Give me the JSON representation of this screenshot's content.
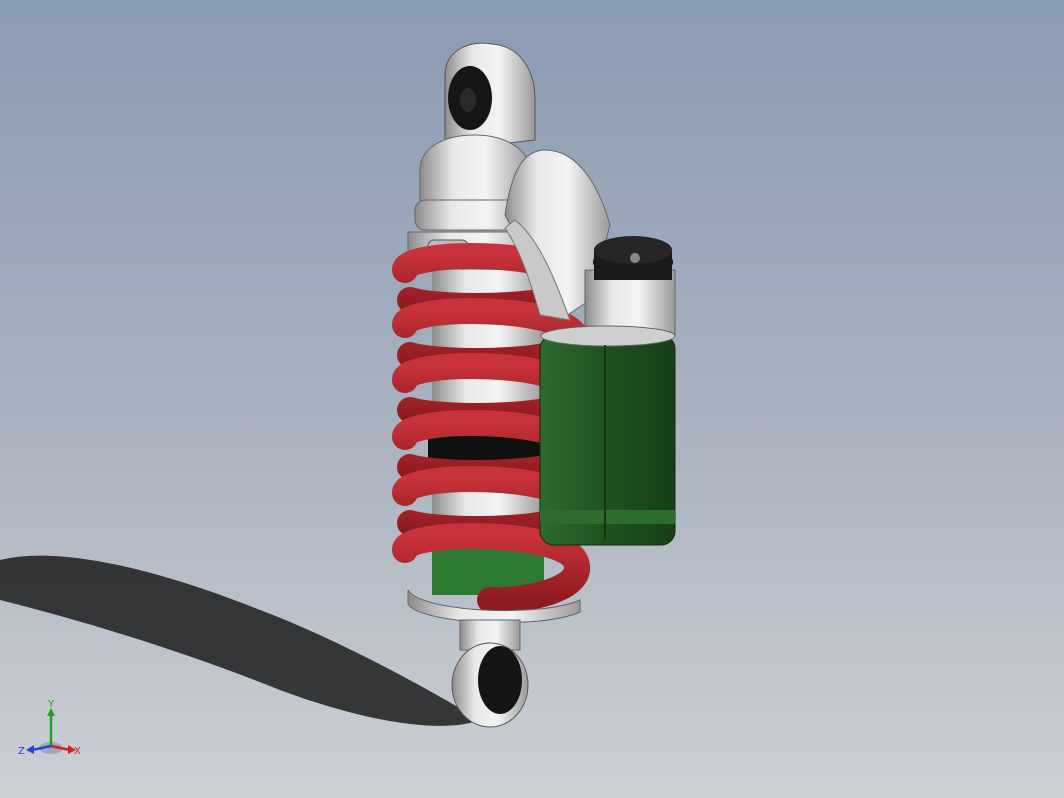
{
  "scene": {
    "model": "shock-absorber",
    "colors": {
      "background_top": "#8a9bb1",
      "background_bottom": "#c8ccd2",
      "spring": "#b3242a",
      "reservoir": "#1f5a24",
      "body_grey": "#d8d8d8",
      "shadow": "#1a1a1a"
    }
  },
  "triad": {
    "x_label": "X",
    "y_label": "Y",
    "z_label": "Z",
    "x_color": "#d42020",
    "y_color": "#1fa31f",
    "z_color": "#2046d4"
  }
}
